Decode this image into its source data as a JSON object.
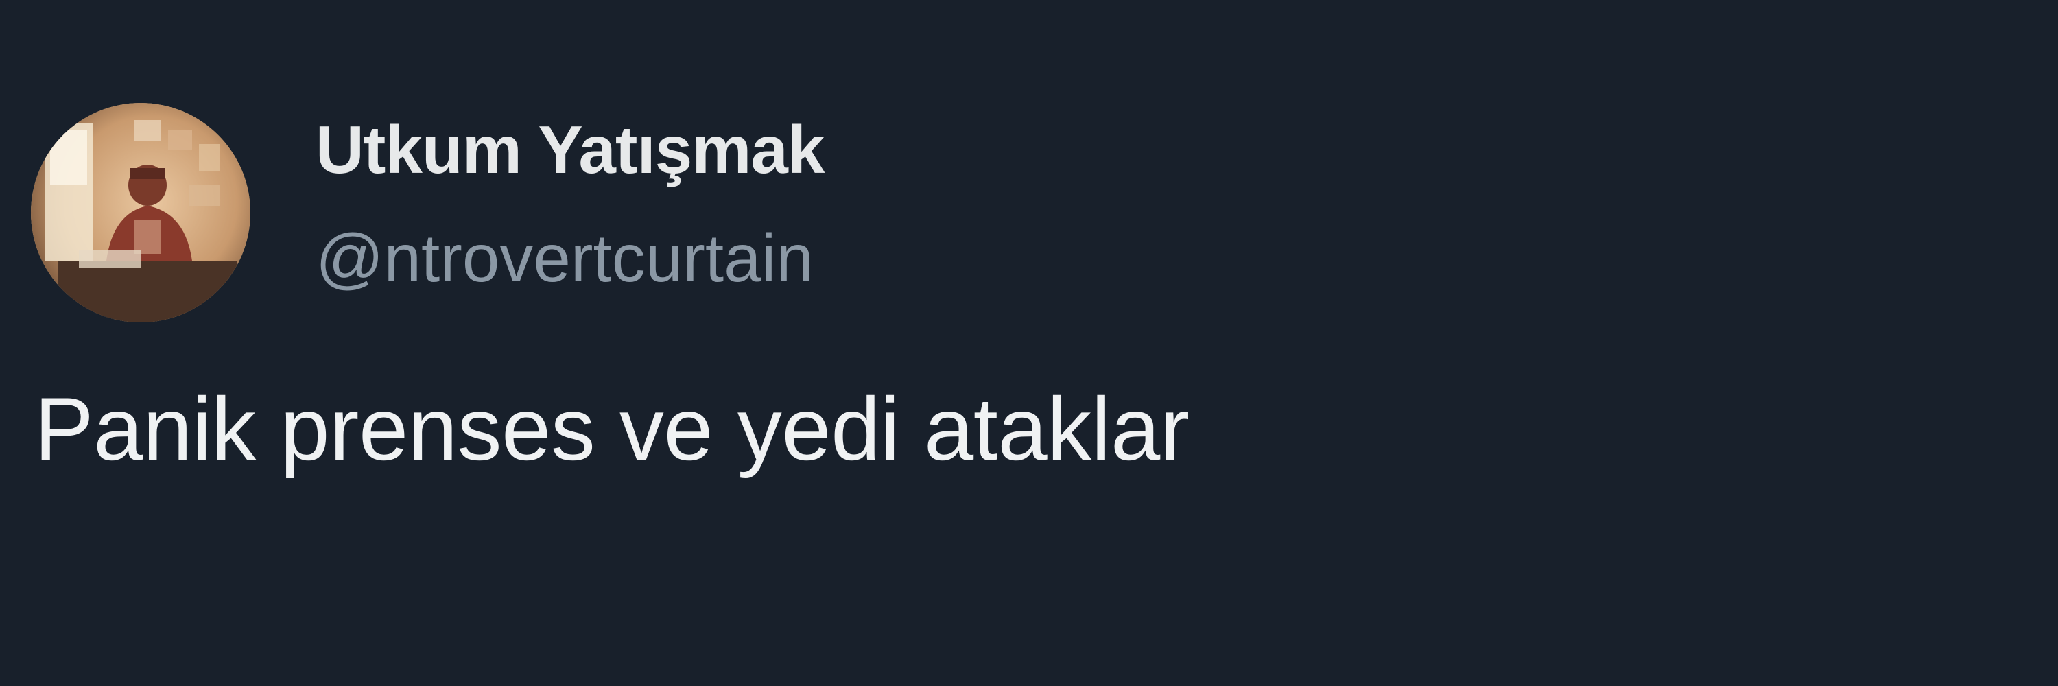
{
  "tweet": {
    "author": {
      "display_name": "Utkum Yatışmak",
      "handle": "@ntrovertcurtain",
      "avatar_icon": "profile-photo"
    },
    "text": "Panik prenses ve yedi ataklar"
  },
  "colors": {
    "background": "#18202b",
    "name": "#e7e9ea",
    "handle": "#8b98a5",
    "text": "#f0f2f3"
  }
}
